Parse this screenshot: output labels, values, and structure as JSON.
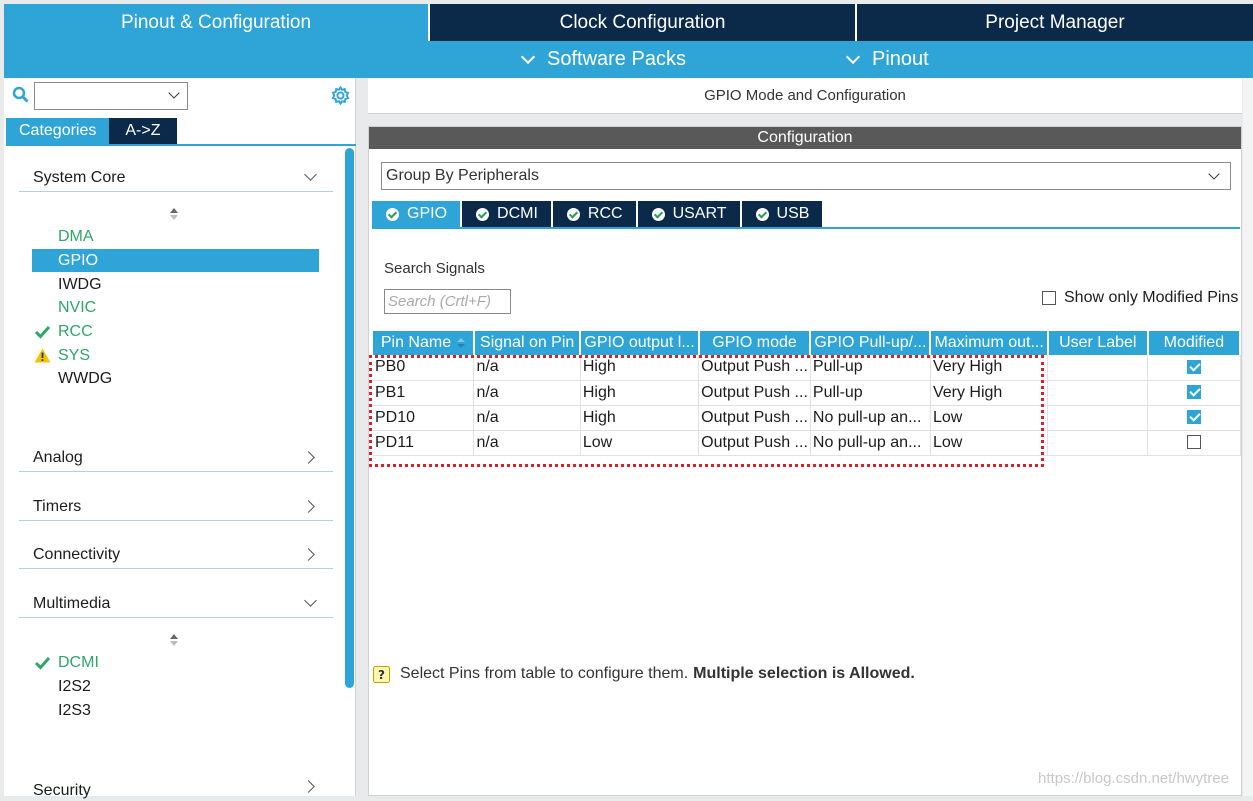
{
  "top_tabs": [
    "Pinout & Configuration",
    "Clock Configuration",
    "Project Manager"
  ],
  "sub_menu": [
    "Software Packs",
    "Pinout"
  ],
  "left": {
    "search_value": "",
    "category_tabs": [
      "Categories",
      "A->Z"
    ],
    "groups": {
      "system_core": "System Core",
      "analog": "Analog",
      "timers": "Timers",
      "connectivity": "Connectivity",
      "multimedia": "Multimedia",
      "security": "Security"
    },
    "system_core_items": [
      "DMA",
      "GPIO",
      "IWDG",
      "NVIC",
      "RCC",
      "SYS",
      "WWDG"
    ],
    "multimedia_items": [
      "DCMI",
      "I2S2",
      "I2S3"
    ]
  },
  "right": {
    "header": "GPIO Mode and Configuration",
    "config_title": "Configuration",
    "group_by": "Group By Peripherals",
    "peripheral_tabs": [
      "GPIO",
      "DCMI",
      "RCC",
      "USART",
      "USB"
    ],
    "search_signals_label": "Search Signals",
    "search_placeholder": "Search (Crtl+F)",
    "show_modified_label": "Show only Modified Pins",
    "columns": [
      "Pin Name",
      "Signal on Pin",
      "GPIO output l...",
      "GPIO mode",
      "GPIO Pull-up/...",
      "Maximum out...",
      "User Label",
      "Modified"
    ],
    "rows": [
      {
        "pin": "PB0",
        "signal": "n/a",
        "level": "High",
        "mode": "Output Push ...",
        "pull": "Pull-up",
        "speed": "Very High",
        "label": "",
        "modified": true
      },
      {
        "pin": "PB1",
        "signal": "n/a",
        "level": "High",
        "mode": "Output Push ...",
        "pull": "Pull-up",
        "speed": "Very High",
        "label": "",
        "modified": true
      },
      {
        "pin": "PD10",
        "signal": "n/a",
        "level": "High",
        "mode": "Output Push ...",
        "pull": "No pull-up an...",
        "speed": "Low",
        "label": "",
        "modified": true
      },
      {
        "pin": "PD11",
        "signal": "n/a",
        "level": "Low",
        "mode": "Output Push ...",
        "pull": "No pull-up an...",
        "speed": "Low",
        "label": "",
        "modified": false
      }
    ],
    "hint_text": "Select Pins from table to configure them.",
    "hint_bold": "Multiple selection is Allowed."
  },
  "watermark": "https://blog.csdn.net/hwytree",
  "colors": {
    "accent": "#2fa5d7",
    "dark": "#0b2a4a",
    "ok_green": "#2ea66a",
    "highlight": "#d0232b"
  }
}
